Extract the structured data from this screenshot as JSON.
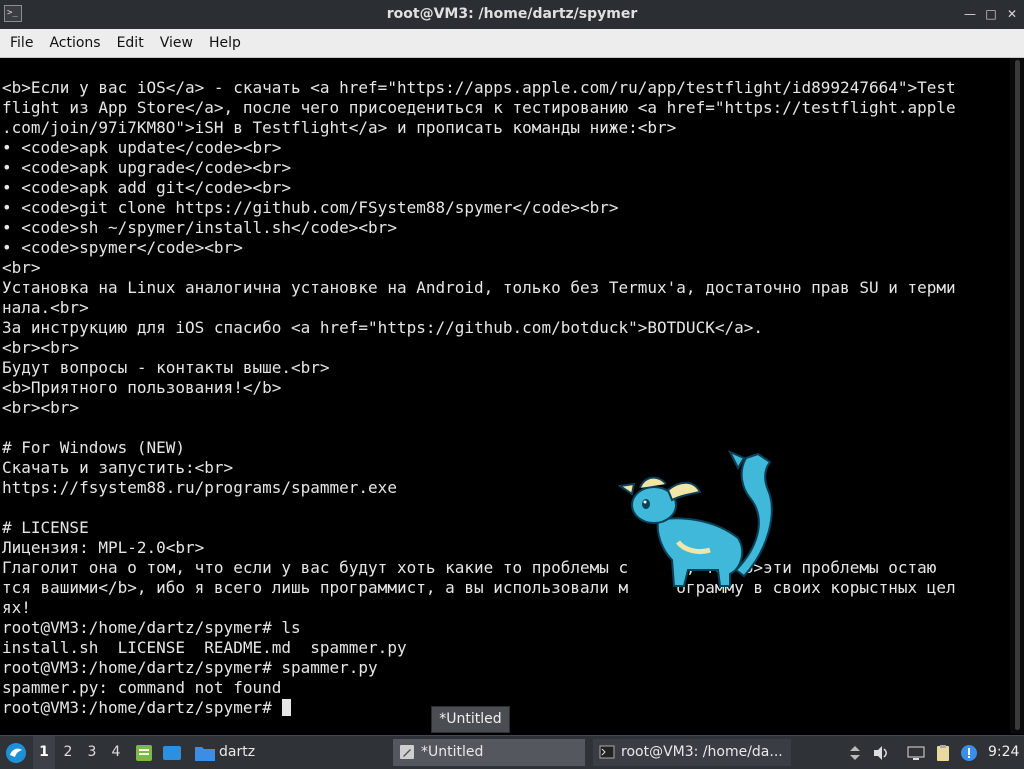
{
  "window": {
    "title": "root@VM3: /home/dartz/spymer"
  },
  "menubar": {
    "items": [
      "File",
      "Actions",
      "Edit",
      "View",
      "Help"
    ]
  },
  "terminal": {
    "lines": [
      "<b>Если у вас iOS</a> - скачать <a href=\"https://apps.apple.com/ru/app/testflight/id899247664\">Test",
      "flight из App Store</a>, после чего присоедениться к тестированию <a href=\"https://testflight.apple",
      ".com/join/97i7KM8O\">iSH в Testflight</a> и прописать команды ниже:<br>",
      "• <code>apk update</code><br>",
      "• <code>apk upgrade</code><br>",
      "• <code>apk add git</code><br>",
      "• <code>git clone https://github.com/FSystem88/spymer</code><br>",
      "• <code>sh ~/spymer/install.sh</code><br>",
      "• <code>spymer</code><br>",
      "<br>",
      "Установка на Linux аналогична установке на Android, только без Termux'а, достаточно прав SU и терми",
      "нала.<br>",
      "За инструкцию для iOS спасибо <a href=\"https://github.com/botduck\">BOTDUCK</a>.",
      "<br><br>",
      "Будут вопросы - контакты выше.<br>",
      "<b>Приятного пользования!</b>",
      "<br><br>",
      "",
      "# For Windows (NEW)",
      "Скачать и запустить:<br>",
      "https://fsystem88.ru/programs/spammer.exe",
      "",
      "# LICENSE",
      "Лицензия: MPL-2.0<br>",
      "Глаголит она о том, что если у вас будут хоть какие то проблемы с     м, то <b>эти проблемы остаю",
      "тся вашими</b>, ибо я всего лишь программист, а вы использовали м     ограмму в своих корыстных цел",
      "ях!",
      "root@VM3:/home/dartz/spymer# ls",
      "install.sh  LICENSE  README.md  spammer.py",
      "root@VM3:/home/dartz/spymer# spammer.py",
      "spammer.py: command not found",
      "root@VM3:/home/dartz/spymer# "
    ]
  },
  "tooltip": {
    "text": "*Untitled"
  },
  "taskbar": {
    "workspaces": [
      "1",
      "2",
      "3",
      "4"
    ],
    "active_workspace": "1",
    "folder_label": "dartz",
    "tasks": {
      "untitled": "*Untitled",
      "terminal": "root@VM3: /home/da..."
    },
    "clock": "9:24"
  },
  "colors": {
    "terminal_bg": "#000000",
    "terminal_fg": "#e6e6e6",
    "pet_body": "#3fb8d9",
    "pet_fin": "#f0e6a8"
  }
}
